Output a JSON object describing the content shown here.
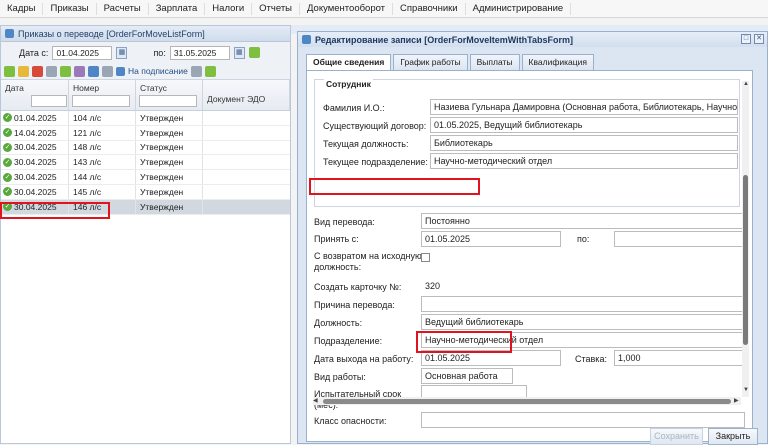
{
  "menu": [
    "Кадры",
    "Приказы",
    "Расчеты",
    "Зарплата",
    "Налоги",
    "Отчеты",
    "Документооборот",
    "Справочники",
    "Администрирование"
  ],
  "list_window": {
    "title": "Приказы о переводе [OrderForMoveListForm]",
    "date_from_label": "Дата с:",
    "date_from": "01.04.2025",
    "date_to_label": "по:",
    "date_to": "31.05.2025",
    "toolbar_label": "На подписание",
    "columns": [
      "Дата",
      "Номер",
      "Статус",
      "Документ ЭДО"
    ],
    "rows": [
      {
        "date": "01.04.2025",
        "number": "104 л/с",
        "status": "Утвержден"
      },
      {
        "date": "14.04.2025",
        "number": "121 л/с",
        "status": "Утвержден"
      },
      {
        "date": "30.04.2025",
        "number": "148 л/с",
        "status": "Утвержден"
      },
      {
        "date": "30.04.2025",
        "number": "143 л/с",
        "status": "Утвержден"
      },
      {
        "date": "30.04.2025",
        "number": "144 л/с",
        "status": "Утвержден"
      },
      {
        "date": "30.04.2025",
        "number": "145 л/с",
        "status": "Утвержден"
      },
      {
        "date": "30.04.2025",
        "number": "146 л/с",
        "status": "Утвержден"
      }
    ]
  },
  "dialog": {
    "title": "Редактирование записи [OrderForMoveItemWithTabsForm]",
    "tabs": [
      "Общие сведения",
      "График работы",
      "Выплаты",
      "Квалификация"
    ],
    "employee_group": "Сотрудник",
    "fio_label": "Фамилия И.О.:",
    "fio_value": "Назиева Гульнара Дамировна (Основная работа, Библиотекарь, Научно-мет",
    "contract_label": "Существующий договор:",
    "contract_value": "01.05.2025, Ведущий библиотекарь",
    "cur_position_label": "Текущая должность:",
    "cur_position_value": "Библиотекарь",
    "cur_dept_label": "Текущее подразделение:",
    "cur_dept_value": "Научно-методический отдел",
    "transfer_type_label": "Вид перевода:",
    "transfer_type_value": "Постоянно",
    "accepted_from_label": "Принять с:",
    "accepted_from_value": "01.05.2025",
    "to_label": "по:",
    "return_label_1": "С возвратом на исходную",
    "return_label_2": "должность:",
    "card_label": "Создать карточку №:",
    "card_value": "320",
    "reason_label": "Причина перевода:",
    "position_label": "Должность:",
    "position_value": "Ведущий библиотекарь",
    "dept_label": "Подразделение:",
    "dept_value": "Научно-методический отдел",
    "start_label": "Дата выхода на работу:",
    "start_value": "01.05.2025",
    "rate_label": "Ставка:",
    "rate_value": "1,000",
    "work_type_label": "Вид работы:",
    "work_type_value": "Основная работа",
    "probation_label_1": "Испытательный срок",
    "probation_label_2": "(мес):",
    "hazard_label": "Класс опасности:",
    "save_button": "Сохранить",
    "close_button": "Закрыть"
  }
}
